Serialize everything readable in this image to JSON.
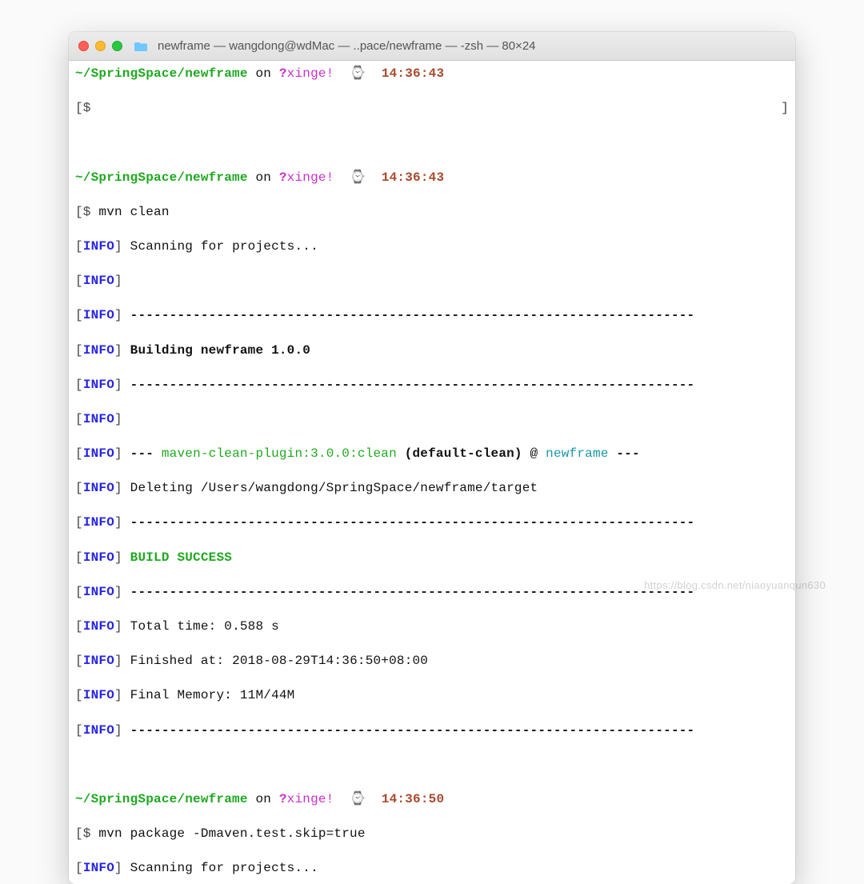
{
  "window": {
    "title": "newframe — wangdong@wdMac — ..pace/newframe — -zsh — 80×24"
  },
  "prompt": {
    "path": "~/SpringSpace/newframe",
    "on": " on ",
    "branch_q": "?",
    "branch": "xinge!",
    "watch": "⌚",
    "time1": "14:36:43",
    "time2": "14:36:43",
    "time3": "14:36:50",
    "ps1": "[$",
    "ps1_end": "]",
    "cmd1": " ",
    "cmd2": " mvn clean",
    "cmd3": " mvn package -Dmaven.test.skip=true"
  },
  "info_tag": {
    "l": "[",
    "t": "INFO",
    "r": "]"
  },
  "lines": {
    "scanning": " Scanning for projects...",
    "building": " Building newframe 1.0.0",
    "plugin_pre": " --- ",
    "plugin_name": "maven-clean-plugin:3.0.0:clean",
    "plugin_phase": " (default-clean)",
    "at": " @ ",
    "project": "newframe",
    "plugin_post": " ---",
    "deleting": " Deleting /Users/wangdong/SpringSpace/newframe/target",
    "success": " BUILD SUCCESS",
    "total_time": " Total time: 0.588 s",
    "finished": " Finished at: 2018-08-29T14:36:50+08:00",
    "memory": " Final Memory: 11M/44M",
    "sep": " ------------------------------------------------------------------------"
  },
  "watermark": "https://blog.csdn.net/niaoyuanqun630"
}
